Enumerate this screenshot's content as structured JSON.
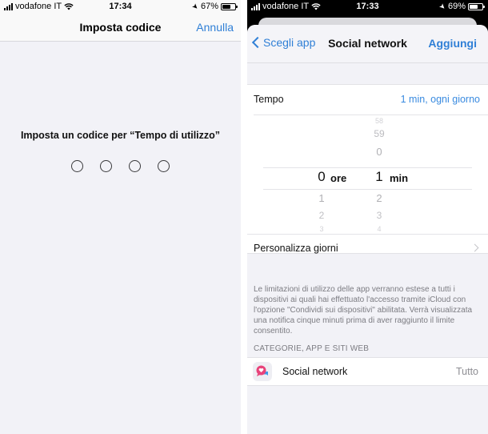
{
  "left_screen": {
    "status_bar": {
      "carrier": "vodafone IT",
      "time": "17:34",
      "battery_percent": "67%",
      "battery_level": 0.67
    },
    "nav": {
      "title": "Imposta codice",
      "cancel_label": "Annulla"
    },
    "prompt": "Imposta un codice per “Tempo di utilizzo”",
    "passcode_digits_total": 4,
    "passcode_digits_entered": 0
  },
  "right_screen": {
    "status_bar": {
      "carrier": "vodafone IT",
      "time": "17:33",
      "battery_percent": "69%",
      "battery_level": 0.69
    },
    "nav": {
      "back_label": "Scegli app",
      "title": "Social network",
      "add_label": "Aggiungi"
    },
    "time_row": {
      "label": "Tempo",
      "value": "1 min, ogni giorno"
    },
    "picker": {
      "hours": {
        "above": [],
        "selected": "0",
        "below": [
          "1",
          "2",
          "3"
        ],
        "unit": "ore"
      },
      "minutes": {
        "above": [
          "58",
          "59",
          "0"
        ],
        "selected": "1",
        "below": [
          "2",
          "3",
          "4"
        ],
        "unit": "min"
      }
    },
    "customize_days_label": "Personalizza giorni",
    "footnote": "Le limitazioni di utilizzo delle app verranno estese a tutti i dispositivi ai quali hai effettuato l'accesso tramite iCloud con l'opzione \"Condividi sui dispositivi\" abilitata. Verrà visualizzata una notifica cinque minuti prima di aver raggiunto il limite consentito.",
    "section_header": "CATEGORIE, APP E SITI WEB",
    "category_row": {
      "label": "Social network",
      "value": "Tutto",
      "icon": "social-network-icon"
    }
  },
  "colors": {
    "accent": "#2f7fd6",
    "background_grouped": "#f2f2f7",
    "secondary_text": "#8e8e93"
  }
}
